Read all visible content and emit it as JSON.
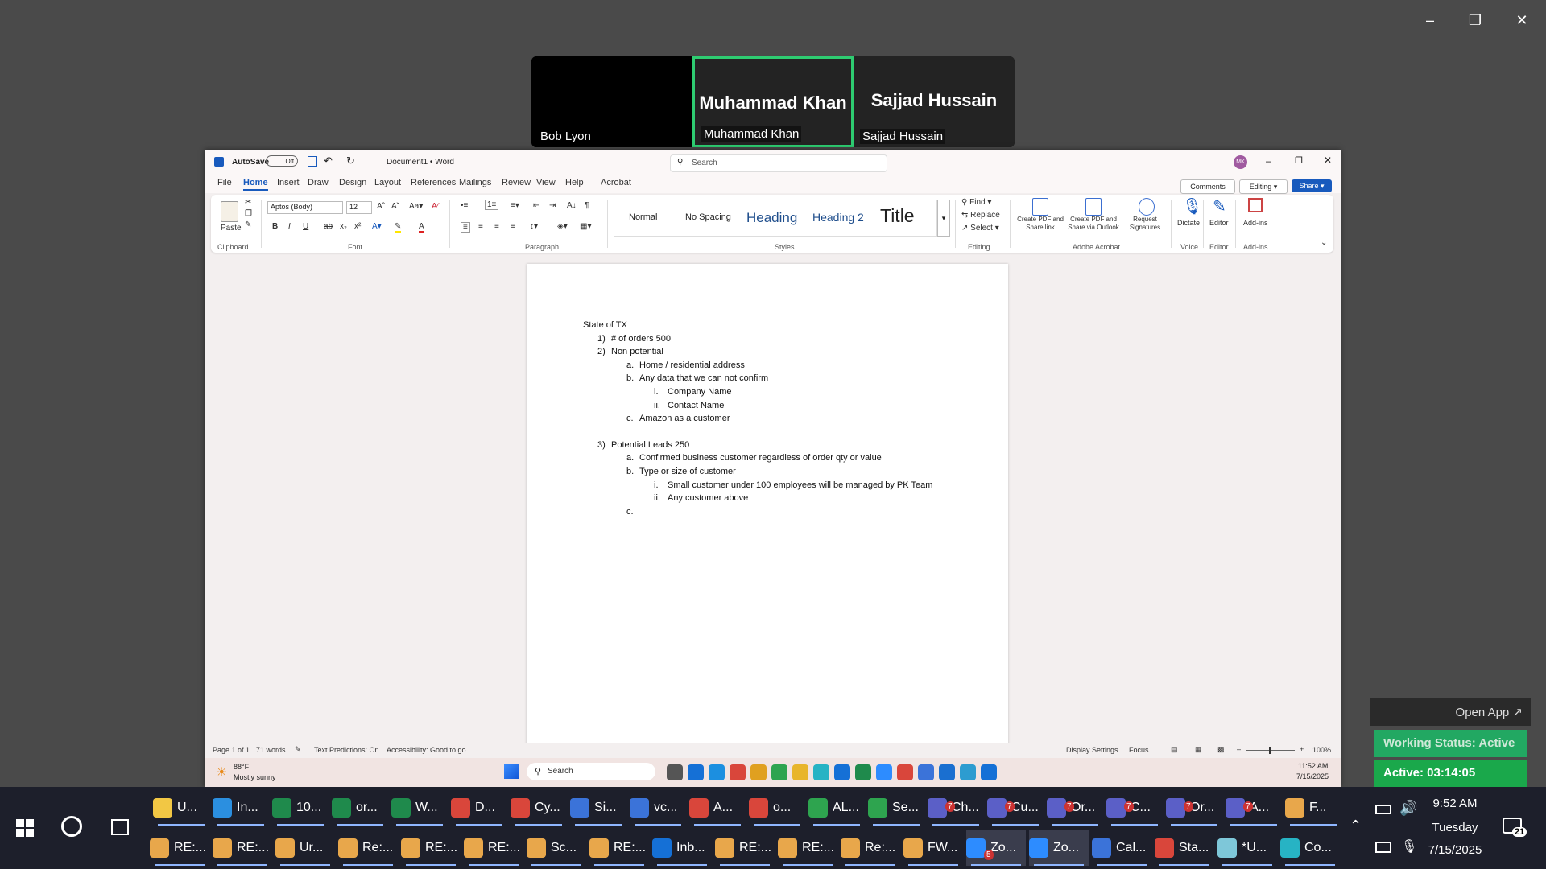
{
  "zoom": {
    "participants": [
      {
        "big": "",
        "label": "Bob Lyon",
        "black": true
      },
      {
        "big": "Muhammad Khan",
        "label": "Muhammad Khan",
        "active": true
      },
      {
        "big": "Sajjad Hussain",
        "label": "Sajjad Hussain"
      }
    ],
    "open_app": "Open App ↗",
    "working_status": "Working Status: Active",
    "active_time": "Active: 03:14:05"
  },
  "word": {
    "autosave_label": "AutoSave",
    "autosave_state": "Off",
    "doc_title": "Document1 • Word",
    "search_placeholder": "Search",
    "avatar_initials": "MK",
    "tabs": [
      "File",
      "Home",
      "Insert",
      "Draw",
      "Design",
      "Layout",
      "References",
      "Mailings",
      "Review",
      "View",
      "Help",
      "Acrobat"
    ],
    "selected_tab": "Home",
    "comments": "Comments",
    "editing": "Editing",
    "share": "Share",
    "ribbon": {
      "paste": "Paste",
      "clipboard": "Clipboard",
      "font_name": "Aptos (Body)",
      "font_size": "12",
      "font": "Font",
      "paragraph": "Paragraph",
      "styles_label": "Styles",
      "styles": [
        "Normal",
        "No Spacing",
        "Heading",
        "Heading 2",
        "Title"
      ],
      "find": "Find",
      "replace": "Replace",
      "select": "Select",
      "editing_group": "Editing",
      "create_pdf_link": "Create PDF and Share link",
      "create_pdf_outlook": "Create PDF and Share via Outlook",
      "request_sig": "Request Signatures",
      "adobe": "Adobe Acrobat",
      "dictate": "Dictate",
      "voice": "Voice",
      "editor": "Editor",
      "editor_group": "Editor",
      "addins": "Add-ins",
      "addins_group": "Add-ins"
    },
    "document": {
      "lines": [
        {
          "marker": "",
          "text": "State of TX",
          "level": 0
        },
        {
          "marker": "1)",
          "text": "# of orders 500",
          "level": 1
        },
        {
          "marker": "2)",
          "text": "Non potential",
          "level": 1
        },
        {
          "marker": "a.",
          "text": "Home / residential address",
          "level": 2
        },
        {
          "marker": "b.",
          "text": "Any data that we can not confirm",
          "level": 2
        },
        {
          "marker": "i.",
          "text": "Company Name",
          "level": 3
        },
        {
          "marker": "ii.",
          "text": "Contact Name",
          "level": 3
        },
        {
          "marker": "c.",
          "text": "Amazon as a customer",
          "level": 2
        },
        {
          "marker": "3)",
          "text": "Potential Leads 250",
          "level": 1,
          "gap": true
        },
        {
          "marker": "a.",
          "text": "Confirmed business customer regardless of order qty or value",
          "level": 2
        },
        {
          "marker": "b.",
          "text": "Type or size of customer",
          "level": 2
        },
        {
          "marker": "i.",
          "text": "Small customer under 100 employees will be managed by PK Team",
          "level": 3
        },
        {
          "marker": "ii.",
          "text": "Any customer above",
          "level": 3
        },
        {
          "marker": "c.",
          "text": "",
          "level": 2
        }
      ]
    },
    "status": {
      "page": "Page 1 of 1",
      "words": "71 words",
      "predictions": "Text Predictions: On",
      "accessibility": "Accessibility: Good to go",
      "display": "Display Settings",
      "focus": "Focus",
      "zoom": "100%"
    },
    "inner_taskbar": {
      "weather_temp": "88°F",
      "weather_desc": "Mostly sunny",
      "search": "Search",
      "time": "11:52 AM",
      "date": "7/15/2025"
    }
  },
  "taskbar": {
    "row1": [
      {
        "label": "U...",
        "color": "#f2c744"
      },
      {
        "label": "In...",
        "color": "#2b8fe0"
      },
      {
        "label": "10...",
        "color": "#1f8a4c"
      },
      {
        "label": "or...",
        "color": "#1f8a4c"
      },
      {
        "label": "W...",
        "color": "#1f8a4c"
      },
      {
        "label": "D...",
        "color": "#d9463b"
      },
      {
        "label": "Cy...",
        "color": "#d9463b"
      },
      {
        "label": "Si...",
        "color": "#3b73d9"
      },
      {
        "label": "vc...",
        "color": "#3b73d9"
      },
      {
        "label": "A...",
        "color": "#d9463b"
      },
      {
        "label": "o...",
        "color": "#d9463b"
      },
      {
        "label": "AL...",
        "color": "#2ea44f"
      },
      {
        "label": "Se...",
        "color": "#2ea44f"
      },
      {
        "label": "Ch...",
        "color": "#5b5fc7"
      },
      {
        "label": "Cu...",
        "color": "#5b5fc7"
      },
      {
        "label": "Or...",
        "color": "#5b5fc7"
      },
      {
        "label": "C...",
        "color": "#5b5fc7"
      },
      {
        "label": "Or...",
        "color": "#5b5fc7"
      },
      {
        "label": "A...",
        "color": "#5b5fc7"
      },
      {
        "label": "F...",
        "color": "#e8a74b"
      }
    ],
    "row2": [
      {
        "label": "RE:...",
        "color": "#e8a74b"
      },
      {
        "label": "RE:...",
        "color": "#e8a74b"
      },
      {
        "label": "Ur...",
        "color": "#e8a74b"
      },
      {
        "label": "Re:...",
        "color": "#e8a74b"
      },
      {
        "label": "RE:...",
        "color": "#e8a74b"
      },
      {
        "label": "RE:...",
        "color": "#e8a74b"
      },
      {
        "label": "Sc...",
        "color": "#e8a74b"
      },
      {
        "label": "RE:...",
        "color": "#e8a74b"
      },
      {
        "label": "Inb...",
        "color": "#1570d6"
      },
      {
        "label": "RE:...",
        "color": "#e8a74b"
      },
      {
        "label": "RE:...",
        "color": "#e8a74b"
      },
      {
        "label": "Re:...",
        "color": "#e8a74b"
      },
      {
        "label": "FW...",
        "color": "#e8a74b"
      },
      {
        "label": "Zo...",
        "color": "#2d8cff"
      },
      {
        "label": "Zo...",
        "color": "#2d8cff"
      },
      {
        "label": "Cal...",
        "color": "#3b73d9"
      },
      {
        "label": "Sta...",
        "color": "#d9463b"
      },
      {
        "label": "*U...",
        "color": "#7ec7d9"
      },
      {
        "label": "Co...",
        "color": "#27b3c4"
      }
    ],
    "badge_teams": "7",
    "badge_zoom": "5",
    "time": "9:52 AM",
    "day": "Tuesday",
    "date": "7/15/2025",
    "notifications": "21"
  }
}
